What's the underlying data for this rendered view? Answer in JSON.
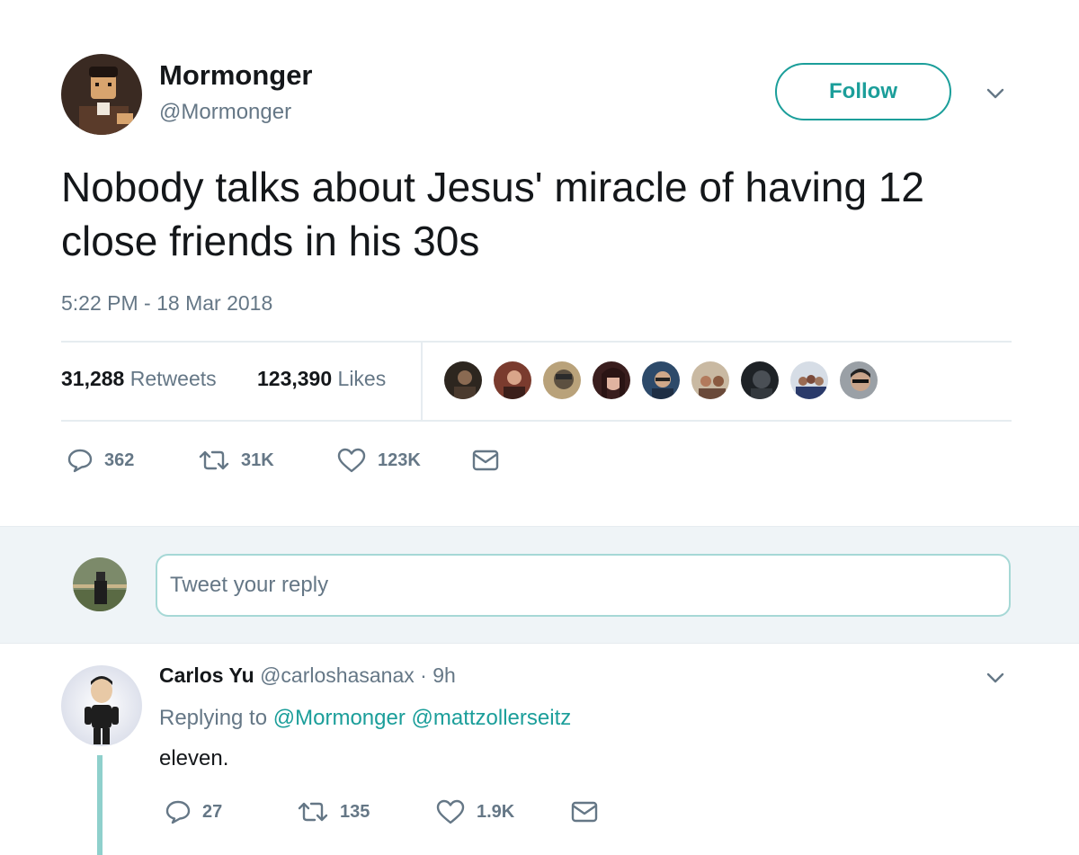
{
  "tweet": {
    "author": {
      "name": "Mormonger",
      "handle": "@Mormonger"
    },
    "follow_label": "Follow",
    "text": "Nobody talks about Jesus' miracle of having 12 close friends in his 30s",
    "timestamp": "5:22 PM - 18 Mar 2018",
    "stats": {
      "retweets_count": "31,288",
      "retweets_label": "Retweets",
      "likes_count": "123,390",
      "likes_label": "Likes"
    },
    "liked_by_count": 9,
    "actions": {
      "replies": "362",
      "retweets": "31K",
      "likes": "123K"
    }
  },
  "reply_box": {
    "placeholder": "Tweet your reply"
  },
  "reply": {
    "author": {
      "name": "Carlos Yu",
      "handle": "@carloshasanax"
    },
    "separator": "·",
    "time": "9h",
    "replying_to_label": "Replying to",
    "mentions": [
      "@Mormonger",
      "@mattzollerseitz"
    ],
    "text": "eleven.",
    "actions": {
      "replies": "27",
      "retweets": "135",
      "likes": "1.9K"
    }
  },
  "icons": [
    "chevron-down-icon",
    "reply-icon",
    "retweet-icon",
    "like-icon",
    "message-icon"
  ],
  "colors": {
    "accent": "#1b9e9a",
    "secondary_text": "#657786",
    "primary_text": "#14171a",
    "divider": "#e6ecf0",
    "reply_bar_bg": "#eff4f7"
  }
}
